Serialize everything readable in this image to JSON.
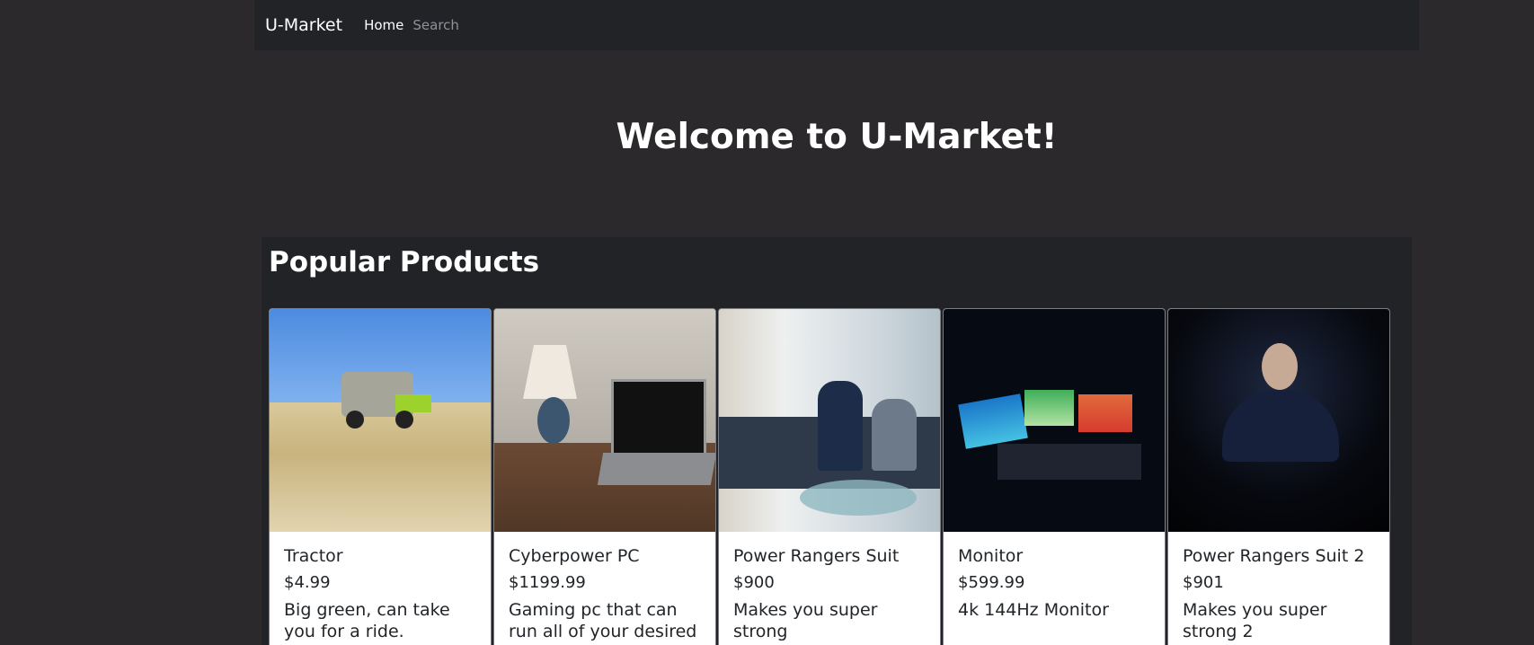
{
  "nav": {
    "brand": "U-Market",
    "home": "Home",
    "search": "Search"
  },
  "hero": {
    "title": "Welcome to U-Market!"
  },
  "popular": {
    "title": "Popular Products",
    "products": [
      {
        "name": "Tractor",
        "price": "$4.99",
        "description": "Big green, can take you for a ride."
      },
      {
        "name": "Cyberpower PC",
        "price": "$1199.99",
        "description": "Gaming pc that can run all of your desired"
      },
      {
        "name": "Power Rangers Suit",
        "price": "$900",
        "description": "Makes you super strong"
      },
      {
        "name": "Monitor",
        "price": "$599.99",
        "description": "4k 144Hz Monitor"
      },
      {
        "name": "Power Rangers Suit 2",
        "price": "$901",
        "description": "Makes you super strong 2"
      }
    ]
  },
  "colors": {
    "page_bg": "#2b292b",
    "navbar_bg": "#212327",
    "card_bg": "#ffffff"
  }
}
